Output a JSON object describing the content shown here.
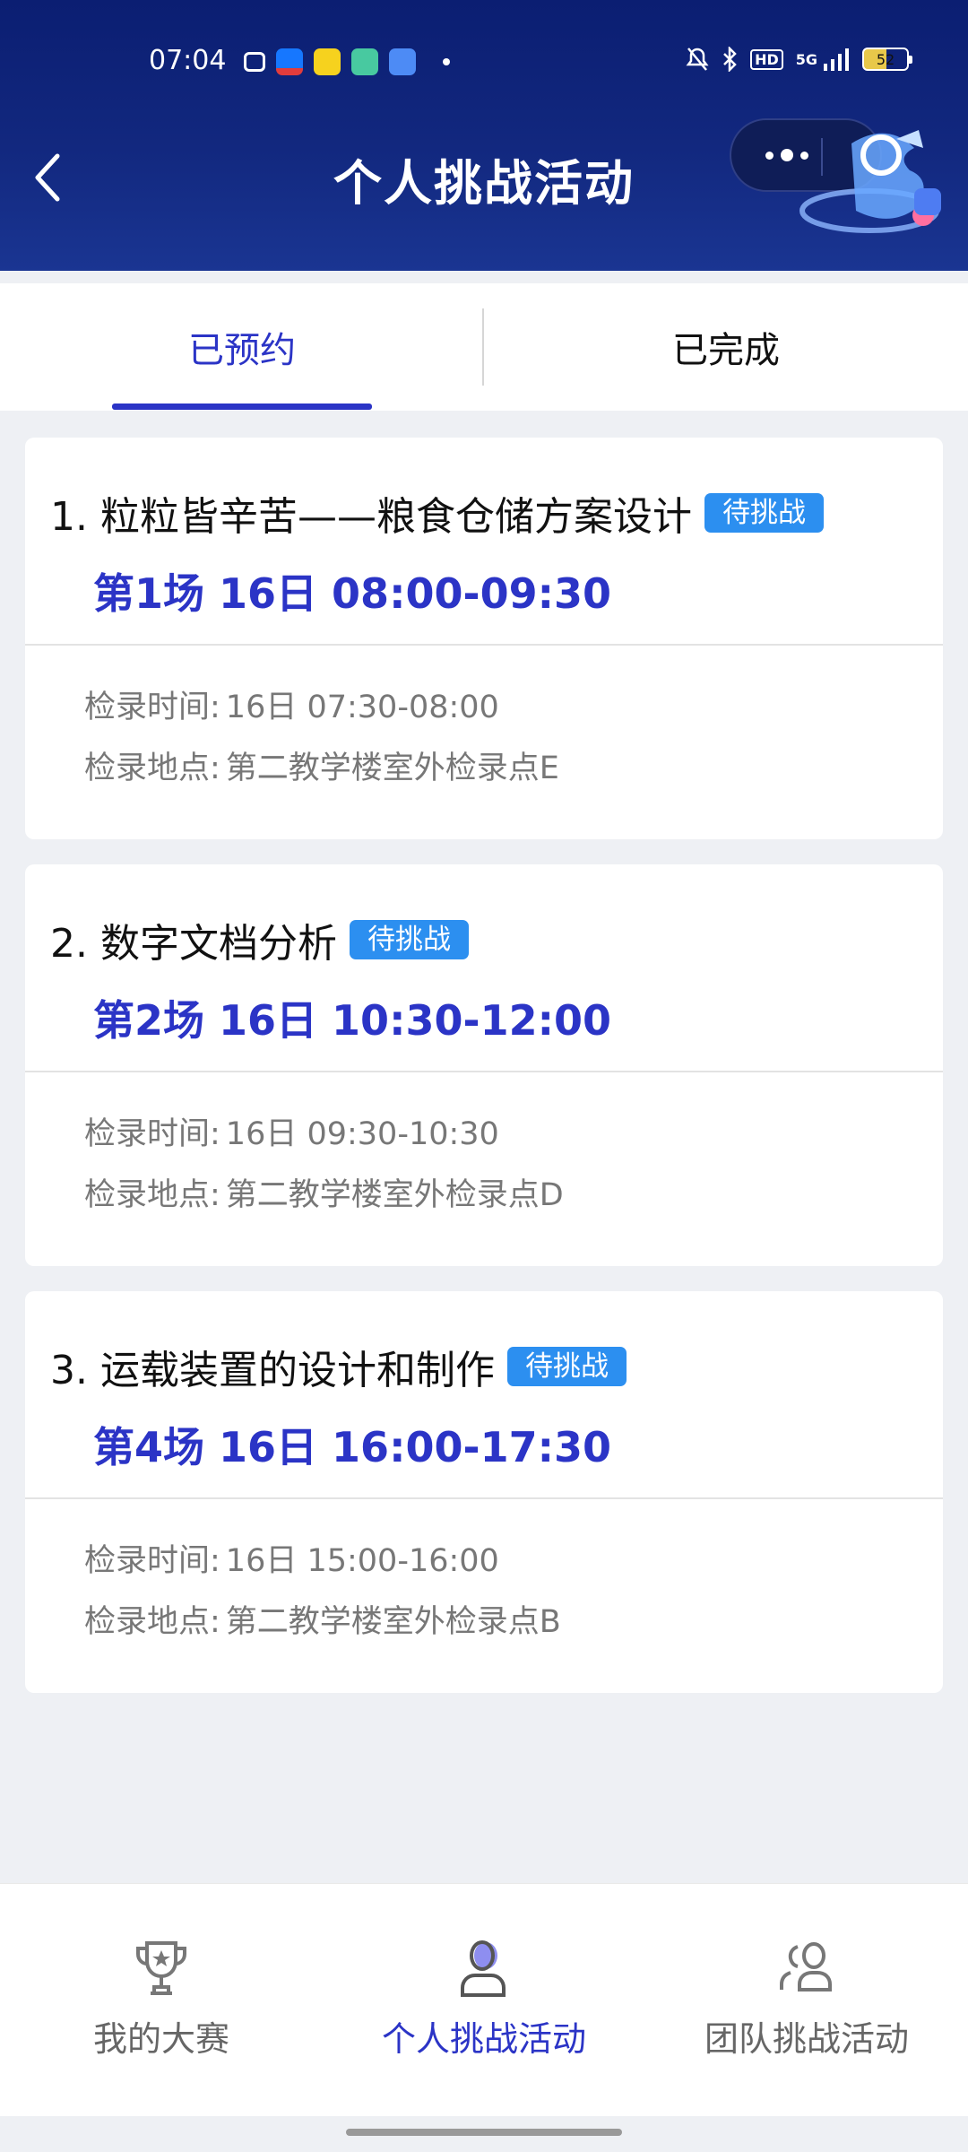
{
  "status_bar": {
    "time": "07:04",
    "network": "5G",
    "hd": "HD",
    "battery": "52",
    "app_icons": [
      "tv-app-icon",
      "alipay-app-icon",
      "yellow-app-icon",
      "green-app-icon",
      "blue-app-icon"
    ]
  },
  "header": {
    "title": "个人挑战活动"
  },
  "tabs": [
    {
      "label": "已预约",
      "active": true
    },
    {
      "label": "已完成",
      "active": false
    }
  ],
  "activities": [
    {
      "title": "1. 粒粒皆辛苦——粮食仓储方案设计",
      "badge": "待挑战",
      "session": "第1场 16日 08:00-09:30",
      "checkin_time_label": "检录时间:",
      "checkin_time": "16日 07:30-08:00",
      "checkin_place_label": "检录地点:",
      "checkin_place": "第二教学楼室外检录点E"
    },
    {
      "title": "2. 数字文档分析",
      "badge": "待挑战",
      "session": "第2场 16日 10:30-12:00",
      "checkin_time_label": "检录时间:",
      "checkin_time": "16日 09:30-10:30",
      "checkin_place_label": "检录地点:",
      "checkin_place": "第二教学楼室外检录点D"
    },
    {
      "title": "3. 运载装置的设计和制作",
      "badge": "待挑战",
      "session": "第4场 16日 16:00-17:30",
      "checkin_time_label": "检录时间:",
      "checkin_time": "16日 15:00-16:00",
      "checkin_place_label": "检录地点:",
      "checkin_place": "第二教学楼室外检录点B"
    }
  ],
  "bottom_nav": [
    {
      "label": "我的大赛",
      "icon": "trophy-icon",
      "active": false
    },
    {
      "label": "个人挑战活动",
      "icon": "person-icon",
      "active": true
    },
    {
      "label": "团队挑战活动",
      "icon": "team-icon",
      "active": false
    }
  ],
  "colors": {
    "accent": "#2b34c6",
    "badge": "#2c8ff0",
    "header_bg": "#0b1e72"
  }
}
